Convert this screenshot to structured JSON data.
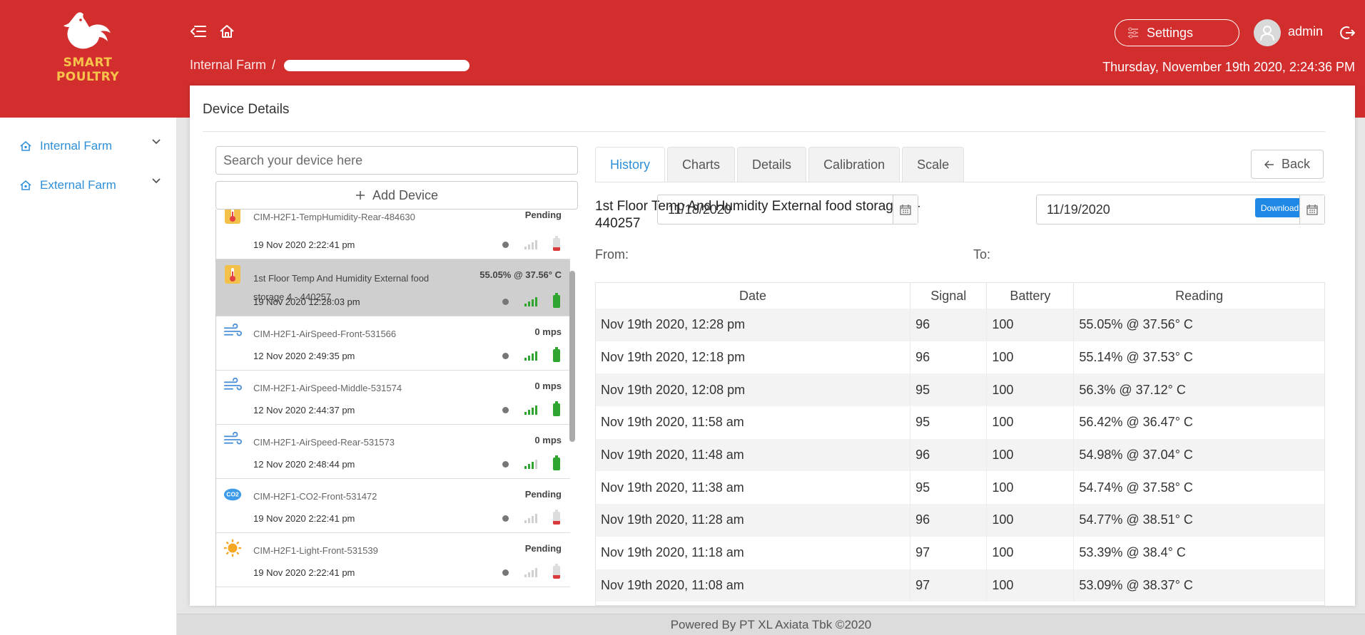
{
  "brand": {
    "logo_text_1": "SMART",
    "logo_text_2": "POULTRY"
  },
  "header": {
    "breadcrumb_root": "Internal Farm",
    "breadcrumb_sep": "/",
    "settings_label": "Settings",
    "username": "admin",
    "datetime": "Thursday, November 19th 2020, 2:24:36 PM"
  },
  "sidebar": {
    "items": [
      {
        "label": "Internal Farm",
        "icon": "home-icon"
      },
      {
        "label": "External Farm",
        "icon": "home-icon"
      }
    ]
  },
  "card": {
    "title": "Device Details"
  },
  "device_list": {
    "search_placeholder": "Search your device here",
    "add_label": "Add Device",
    "devices": [
      {
        "name": "CIM-H2F1-TempHumidity-Rear-484630",
        "time": "19 Nov 2020 2:22:41 pm",
        "value": "Pending",
        "icon": "thermometer-icon",
        "signal": 0,
        "battery": "low"
      },
      {
        "name": "1st Floor Temp And Humidity External food storage 4 - 440257",
        "time": "19 Nov 2020 12:28:03 pm",
        "value": "55.05% @ 37.56° C",
        "icon": "thermometer-icon",
        "signal": 4,
        "battery": "full"
      },
      {
        "name": "CIM-H2F1-AirSpeed-Front-531566",
        "time": "12 Nov 2020 2:49:35 pm",
        "value": "0 mps",
        "icon": "wind-icon",
        "signal": 4,
        "battery": "full"
      },
      {
        "name": "CIM-H2F1-AirSpeed-Middle-531574",
        "time": "12 Nov 2020 2:44:37 pm",
        "value": "0 mps",
        "icon": "wind-icon",
        "signal": 4,
        "battery": "full"
      },
      {
        "name": "CIM-H2F1-AirSpeed-Rear-531573",
        "time": "12 Nov 2020 2:48:44 pm",
        "value": "0 mps",
        "icon": "wind-icon",
        "signal": 3,
        "battery": "full"
      },
      {
        "name": "CIM-H2F1-CO2-Front-531472",
        "time": "19 Nov 2020 2:22:41 pm",
        "value": "Pending",
        "icon": "co2-icon",
        "signal": 0,
        "battery": "low"
      },
      {
        "name": "CIM-H2F1-Light-Front-531539",
        "time": "19 Nov 2020 2:22:41 pm",
        "value": "Pending",
        "icon": "sun-icon",
        "signal": 0,
        "battery": "low"
      }
    ]
  },
  "tabs": [
    {
      "label": "History",
      "active": true
    },
    {
      "label": "Charts",
      "active": false
    },
    {
      "label": "Details",
      "active": false
    },
    {
      "label": "Calibration",
      "active": false
    },
    {
      "label": "Scale",
      "active": false
    }
  ],
  "back_label": "Back",
  "detail": {
    "heading": "1st Floor Temp And Humidity External food storage 4 - 440257",
    "csv_label": "Download CSV",
    "from_label": "From:",
    "to_label": "To:",
    "from_value": "11/18/2020",
    "to_value": "11/19/2020"
  },
  "history": {
    "columns": [
      "Date",
      "Signal",
      "Battery",
      "Reading"
    ],
    "rows": [
      [
        "Nov 19th 2020, 12:28 pm",
        "96",
        "100",
        "55.05% @ 37.56° C"
      ],
      [
        "Nov 19th 2020, 12:18 pm",
        "96",
        "100",
        "55.14% @ 37.53° C"
      ],
      [
        "Nov 19th 2020, 12:08 pm",
        "95",
        "100",
        "56.3% @ 37.12° C"
      ],
      [
        "Nov 19th 2020, 11:58 am",
        "95",
        "100",
        "56.42% @ 36.47° C"
      ],
      [
        "Nov 19th 2020, 11:48 am",
        "96",
        "100",
        "54.98% @ 37.04° C"
      ],
      [
        "Nov 19th 2020, 11:38 am",
        "95",
        "100",
        "54.74% @ 37.58° C"
      ],
      [
        "Nov 19th 2020, 11:28 am",
        "96",
        "100",
        "54.77% @ 38.51° C"
      ],
      [
        "Nov 19th 2020, 11:18 am",
        "97",
        "100",
        "53.39% @ 38.4° C"
      ],
      [
        "Nov 19th 2020, 11:08 am",
        "97",
        "100",
        "53.09% @ 38.37° C"
      ]
    ]
  },
  "footer": {
    "text": "Powered By PT XL Axiata Tbk ©2020"
  },
  "colors": {
    "brand_red": "#d22e2e",
    "accent_blue": "#2e8fd8",
    "logo_gold": "#f7c34a",
    "csv_blue": "#1e88e5"
  }
}
